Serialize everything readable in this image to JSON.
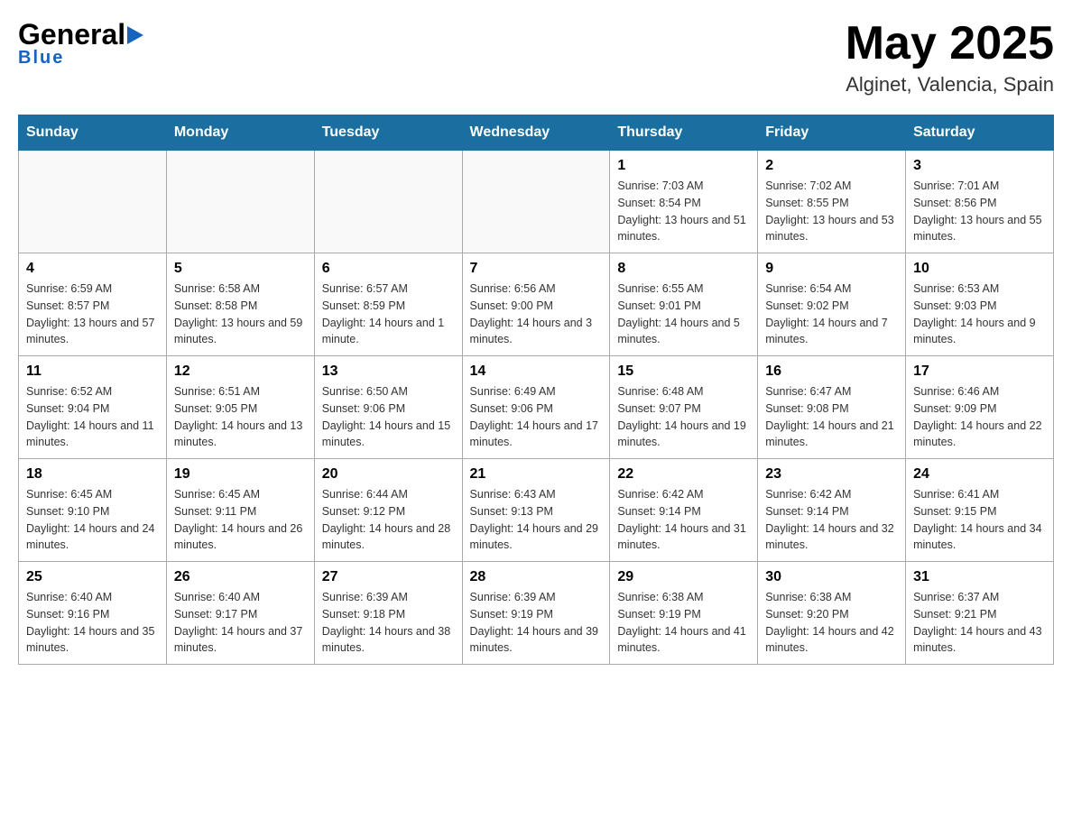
{
  "header": {
    "logo_general": "General",
    "logo_blue": "Blue",
    "month_year": "May 2025",
    "location": "Alginet, Valencia, Spain"
  },
  "weekdays": [
    "Sunday",
    "Monday",
    "Tuesday",
    "Wednesday",
    "Thursday",
    "Friday",
    "Saturday"
  ],
  "weeks": [
    [
      {
        "day": "",
        "info": ""
      },
      {
        "day": "",
        "info": ""
      },
      {
        "day": "",
        "info": ""
      },
      {
        "day": "",
        "info": ""
      },
      {
        "day": "1",
        "info": "Sunrise: 7:03 AM\nSunset: 8:54 PM\nDaylight: 13 hours and 51 minutes."
      },
      {
        "day": "2",
        "info": "Sunrise: 7:02 AM\nSunset: 8:55 PM\nDaylight: 13 hours and 53 minutes."
      },
      {
        "day": "3",
        "info": "Sunrise: 7:01 AM\nSunset: 8:56 PM\nDaylight: 13 hours and 55 minutes."
      }
    ],
    [
      {
        "day": "4",
        "info": "Sunrise: 6:59 AM\nSunset: 8:57 PM\nDaylight: 13 hours and 57 minutes."
      },
      {
        "day": "5",
        "info": "Sunrise: 6:58 AM\nSunset: 8:58 PM\nDaylight: 13 hours and 59 minutes."
      },
      {
        "day": "6",
        "info": "Sunrise: 6:57 AM\nSunset: 8:59 PM\nDaylight: 14 hours and 1 minute."
      },
      {
        "day": "7",
        "info": "Sunrise: 6:56 AM\nSunset: 9:00 PM\nDaylight: 14 hours and 3 minutes."
      },
      {
        "day": "8",
        "info": "Sunrise: 6:55 AM\nSunset: 9:01 PM\nDaylight: 14 hours and 5 minutes."
      },
      {
        "day": "9",
        "info": "Sunrise: 6:54 AM\nSunset: 9:02 PM\nDaylight: 14 hours and 7 minutes."
      },
      {
        "day": "10",
        "info": "Sunrise: 6:53 AM\nSunset: 9:03 PM\nDaylight: 14 hours and 9 minutes."
      }
    ],
    [
      {
        "day": "11",
        "info": "Sunrise: 6:52 AM\nSunset: 9:04 PM\nDaylight: 14 hours and 11 minutes."
      },
      {
        "day": "12",
        "info": "Sunrise: 6:51 AM\nSunset: 9:05 PM\nDaylight: 14 hours and 13 minutes."
      },
      {
        "day": "13",
        "info": "Sunrise: 6:50 AM\nSunset: 9:06 PM\nDaylight: 14 hours and 15 minutes."
      },
      {
        "day": "14",
        "info": "Sunrise: 6:49 AM\nSunset: 9:06 PM\nDaylight: 14 hours and 17 minutes."
      },
      {
        "day": "15",
        "info": "Sunrise: 6:48 AM\nSunset: 9:07 PM\nDaylight: 14 hours and 19 minutes."
      },
      {
        "day": "16",
        "info": "Sunrise: 6:47 AM\nSunset: 9:08 PM\nDaylight: 14 hours and 21 minutes."
      },
      {
        "day": "17",
        "info": "Sunrise: 6:46 AM\nSunset: 9:09 PM\nDaylight: 14 hours and 22 minutes."
      }
    ],
    [
      {
        "day": "18",
        "info": "Sunrise: 6:45 AM\nSunset: 9:10 PM\nDaylight: 14 hours and 24 minutes."
      },
      {
        "day": "19",
        "info": "Sunrise: 6:45 AM\nSunset: 9:11 PM\nDaylight: 14 hours and 26 minutes."
      },
      {
        "day": "20",
        "info": "Sunrise: 6:44 AM\nSunset: 9:12 PM\nDaylight: 14 hours and 28 minutes."
      },
      {
        "day": "21",
        "info": "Sunrise: 6:43 AM\nSunset: 9:13 PM\nDaylight: 14 hours and 29 minutes."
      },
      {
        "day": "22",
        "info": "Sunrise: 6:42 AM\nSunset: 9:14 PM\nDaylight: 14 hours and 31 minutes."
      },
      {
        "day": "23",
        "info": "Sunrise: 6:42 AM\nSunset: 9:14 PM\nDaylight: 14 hours and 32 minutes."
      },
      {
        "day": "24",
        "info": "Sunrise: 6:41 AM\nSunset: 9:15 PM\nDaylight: 14 hours and 34 minutes."
      }
    ],
    [
      {
        "day": "25",
        "info": "Sunrise: 6:40 AM\nSunset: 9:16 PM\nDaylight: 14 hours and 35 minutes."
      },
      {
        "day": "26",
        "info": "Sunrise: 6:40 AM\nSunset: 9:17 PM\nDaylight: 14 hours and 37 minutes."
      },
      {
        "day": "27",
        "info": "Sunrise: 6:39 AM\nSunset: 9:18 PM\nDaylight: 14 hours and 38 minutes."
      },
      {
        "day": "28",
        "info": "Sunrise: 6:39 AM\nSunset: 9:19 PM\nDaylight: 14 hours and 39 minutes."
      },
      {
        "day": "29",
        "info": "Sunrise: 6:38 AM\nSunset: 9:19 PM\nDaylight: 14 hours and 41 minutes."
      },
      {
        "day": "30",
        "info": "Sunrise: 6:38 AM\nSunset: 9:20 PM\nDaylight: 14 hours and 42 minutes."
      },
      {
        "day": "31",
        "info": "Sunrise: 6:37 AM\nSunset: 9:21 PM\nDaylight: 14 hours and 43 minutes."
      }
    ]
  ]
}
